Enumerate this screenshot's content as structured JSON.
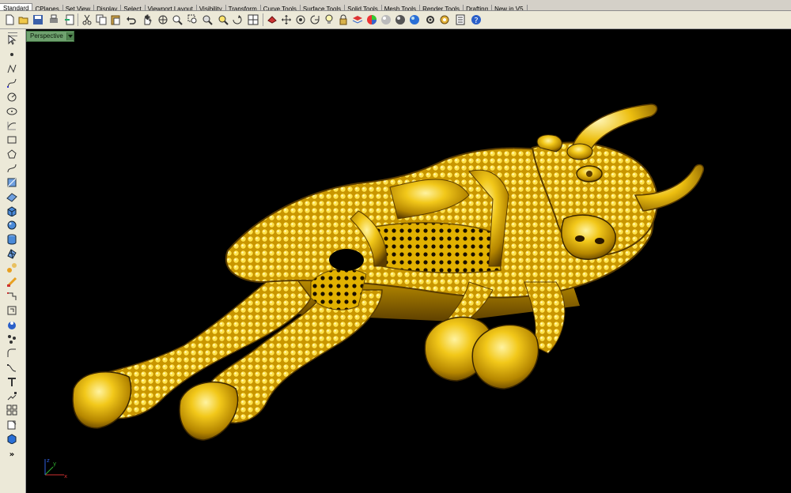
{
  "tabs": [
    {
      "label": "Standard"
    },
    {
      "label": "CPlanes"
    },
    {
      "label": "Set View"
    },
    {
      "label": "Display"
    },
    {
      "label": "Select"
    },
    {
      "label": "Viewport Layout"
    },
    {
      "label": "Visibility"
    },
    {
      "label": "Transform"
    },
    {
      "label": "Curve Tools"
    },
    {
      "label": "Surface Tools"
    },
    {
      "label": "Solid Tools"
    },
    {
      "label": "Mesh Tools"
    },
    {
      "label": "Render Tools"
    },
    {
      "label": "Drafting"
    },
    {
      "label": "New in V5"
    }
  ],
  "viewport": {
    "title": "Perspective"
  },
  "axis": {
    "x": "x",
    "y": "y",
    "z": "z"
  },
  "overflow_label": "»",
  "colors": {
    "gold": "#e8b800",
    "viewport_bg": "#000000",
    "viewport_tab": "#6fa26f"
  }
}
